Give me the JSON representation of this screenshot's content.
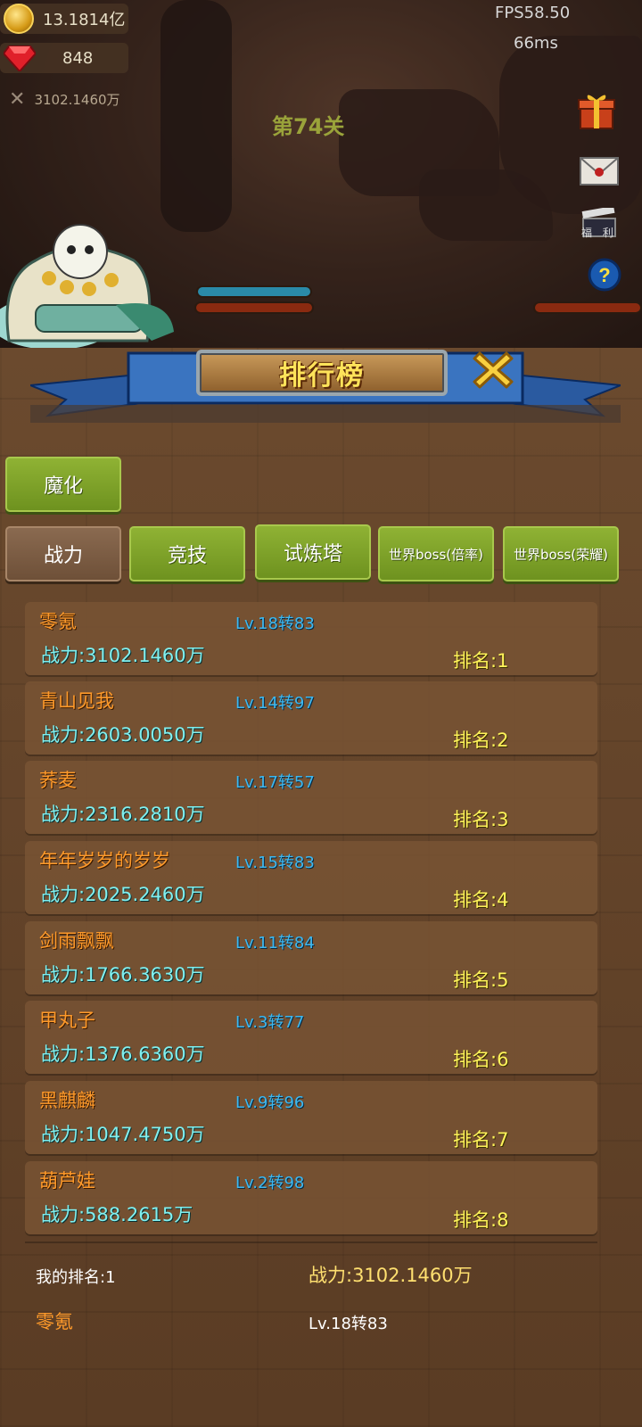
{
  "hud": {
    "gold": "13.1814亿",
    "gems": "848",
    "combat_power": "3102.1460万",
    "fps": "FPS58.50",
    "latency": "66ms",
    "stage": "第74关",
    "welfare_label": "福 利"
  },
  "panel": {
    "title": "排行榜",
    "tabs_row1": [
      {
        "label": "魔化"
      }
    ],
    "tabs_row2": [
      {
        "label": "战力",
        "active": true
      },
      {
        "label": "竞技"
      },
      {
        "label": "试炼塔"
      },
      {
        "label": "世界boss(倍率)"
      },
      {
        "label": "世界boss(荣耀)"
      }
    ],
    "rows": [
      {
        "name": "零氪",
        "level": "Lv.18转83",
        "power": "战力:3102.1460万",
        "rank": "排名:1"
      },
      {
        "name": "青山见我",
        "level": "Lv.14转97",
        "power": "战力:2603.0050万",
        "rank": "排名:2"
      },
      {
        "name": "荞麦",
        "level": "Lv.17转57",
        "power": "战力:2316.2810万",
        "rank": "排名:3"
      },
      {
        "name": "年年岁岁的岁岁",
        "level": "Lv.15转83",
        "power": "战力:2025.2460万",
        "rank": "排名:4"
      },
      {
        "name": "剑雨飘飘",
        "level": "Lv.11转84",
        "power": "战力:1766.3630万",
        "rank": "排名:5"
      },
      {
        "name": "甲丸子",
        "level": "Lv.3转77",
        "power": "战力:1376.6360万",
        "rank": "排名:6"
      },
      {
        "name": "黑麒麟",
        "level": "Lv.9转96",
        "power": "战力:1047.4750万",
        "rank": "排名:7"
      },
      {
        "name": "葫芦娃",
        "level": "Lv.2转98",
        "power": "战力:588.2615万",
        "rank": "排名:8"
      }
    ],
    "my": {
      "rank_label": "我的排名:1",
      "power": "战力:3102.1460万",
      "name": "零氪",
      "level": "Lv.18转83"
    }
  },
  "colors": {
    "tab_green": "#7fa22a",
    "tab_brown": "#7a5c44",
    "name_orange": "#ff9a2a",
    "level_blue": "#3db8f0",
    "power_cyan": "#80f0f0",
    "rank_yellow": "#fff35a",
    "title_yellow": "#ffe35a"
  },
  "icons": {
    "gold": "coin-icon",
    "gems": "gem-icon",
    "combat_power": "sword-icon",
    "gift": "gift-icon",
    "mail": "mail-icon",
    "video": "film-icon",
    "help": "help-icon",
    "close": "close-icon"
  }
}
